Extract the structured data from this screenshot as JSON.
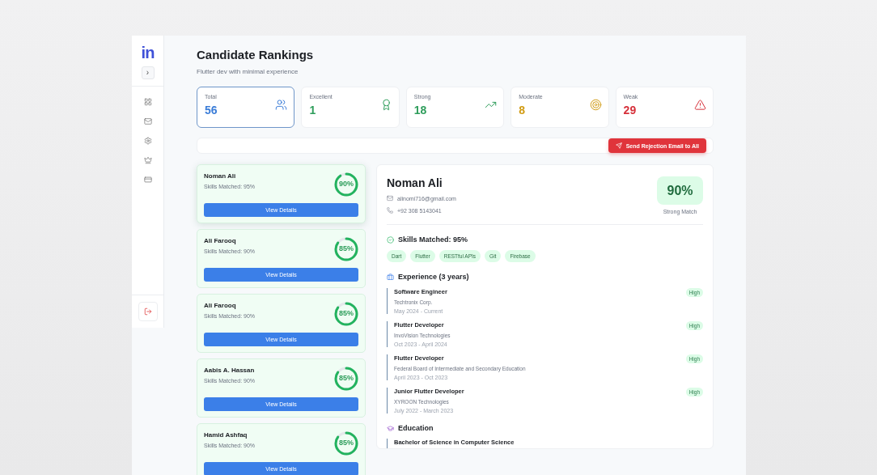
{
  "sidebar": {
    "logo": "in",
    "toggle": "›"
  },
  "header": {
    "title": "Candidate Rankings",
    "subtitle": "Flutter dev with minimal experience"
  },
  "stats": [
    {
      "kind": "total",
      "label": "Total",
      "value": "56",
      "color": "#3b7dd8",
      "selected": true
    },
    {
      "kind": "excellent",
      "label": "Excellent",
      "value": "1",
      "color": "#2e9d5b",
      "selected": false
    },
    {
      "kind": "strong",
      "label": "Strong",
      "value": "18",
      "color": "#2e9d5b",
      "selected": false
    },
    {
      "kind": "moderate",
      "label": "Moderate",
      "value": "8",
      "color": "#d19b12",
      "selected": false
    },
    {
      "kind": "weak",
      "label": "Weak",
      "value": "29",
      "color": "#d6303a",
      "selected": false
    }
  ],
  "action_button": "Send Rejection Email to All",
  "candidates": [
    {
      "name": "Noman Ali",
      "skills": "Skills Matched: 95%",
      "score": "90%",
      "level": 0.9,
      "selected": true,
      "button": "View Details"
    },
    {
      "name": "Ali Farooq",
      "skills": "Skills Matched: 90%",
      "score": "85%",
      "level": 0.85,
      "selected": false,
      "button": "View Details"
    },
    {
      "name": "Ali Farooq",
      "skills": "Skills Matched: 90%",
      "score": "85%",
      "level": 0.85,
      "selected": false,
      "button": "View Details"
    },
    {
      "name": "Aabis A. Hassan",
      "skills": "Skills Matched: 90%",
      "score": "85%",
      "level": 0.85,
      "selected": false,
      "button": "View Details"
    },
    {
      "name": "Hamid Ashfaq",
      "skills": "Skills Matched: 90%",
      "score": "85%",
      "level": 0.85,
      "selected": false,
      "button": "View Details"
    }
  ],
  "detail": {
    "name": "Noman Ali",
    "email": "alinomi716@gmail.com",
    "phone": "+92 308 5143041",
    "score": "90%",
    "match_label": "Strong Match",
    "skills_title": "Skills Matched: 95%",
    "skills": [
      "Dart",
      "Flutter",
      "RESTful APIs",
      "Git",
      "Firebase"
    ],
    "experience_title": "Experience (3 years)",
    "experience": [
      {
        "title": "Software Engineer",
        "company": "Techtronix Corp.",
        "dates": "May 2024 - Current",
        "badge": "High"
      },
      {
        "title": "Flutter Developer",
        "company": "InvoVision Technologies",
        "dates": "Oct 2023 - April 2024",
        "badge": "High"
      },
      {
        "title": "Flutter Developer",
        "company": "Federal Board of Intermediate and Secondary Education",
        "dates": "April 2023 - Oct 2023",
        "badge": "High"
      },
      {
        "title": "Junior Flutter Developer",
        "company": "XYROON Technologies",
        "dates": "July 2022 - March 2023",
        "badge": "High"
      }
    ],
    "education_title": "Education",
    "education": [
      {
        "degree": "Bachelor of Science in Computer Science"
      }
    ]
  }
}
